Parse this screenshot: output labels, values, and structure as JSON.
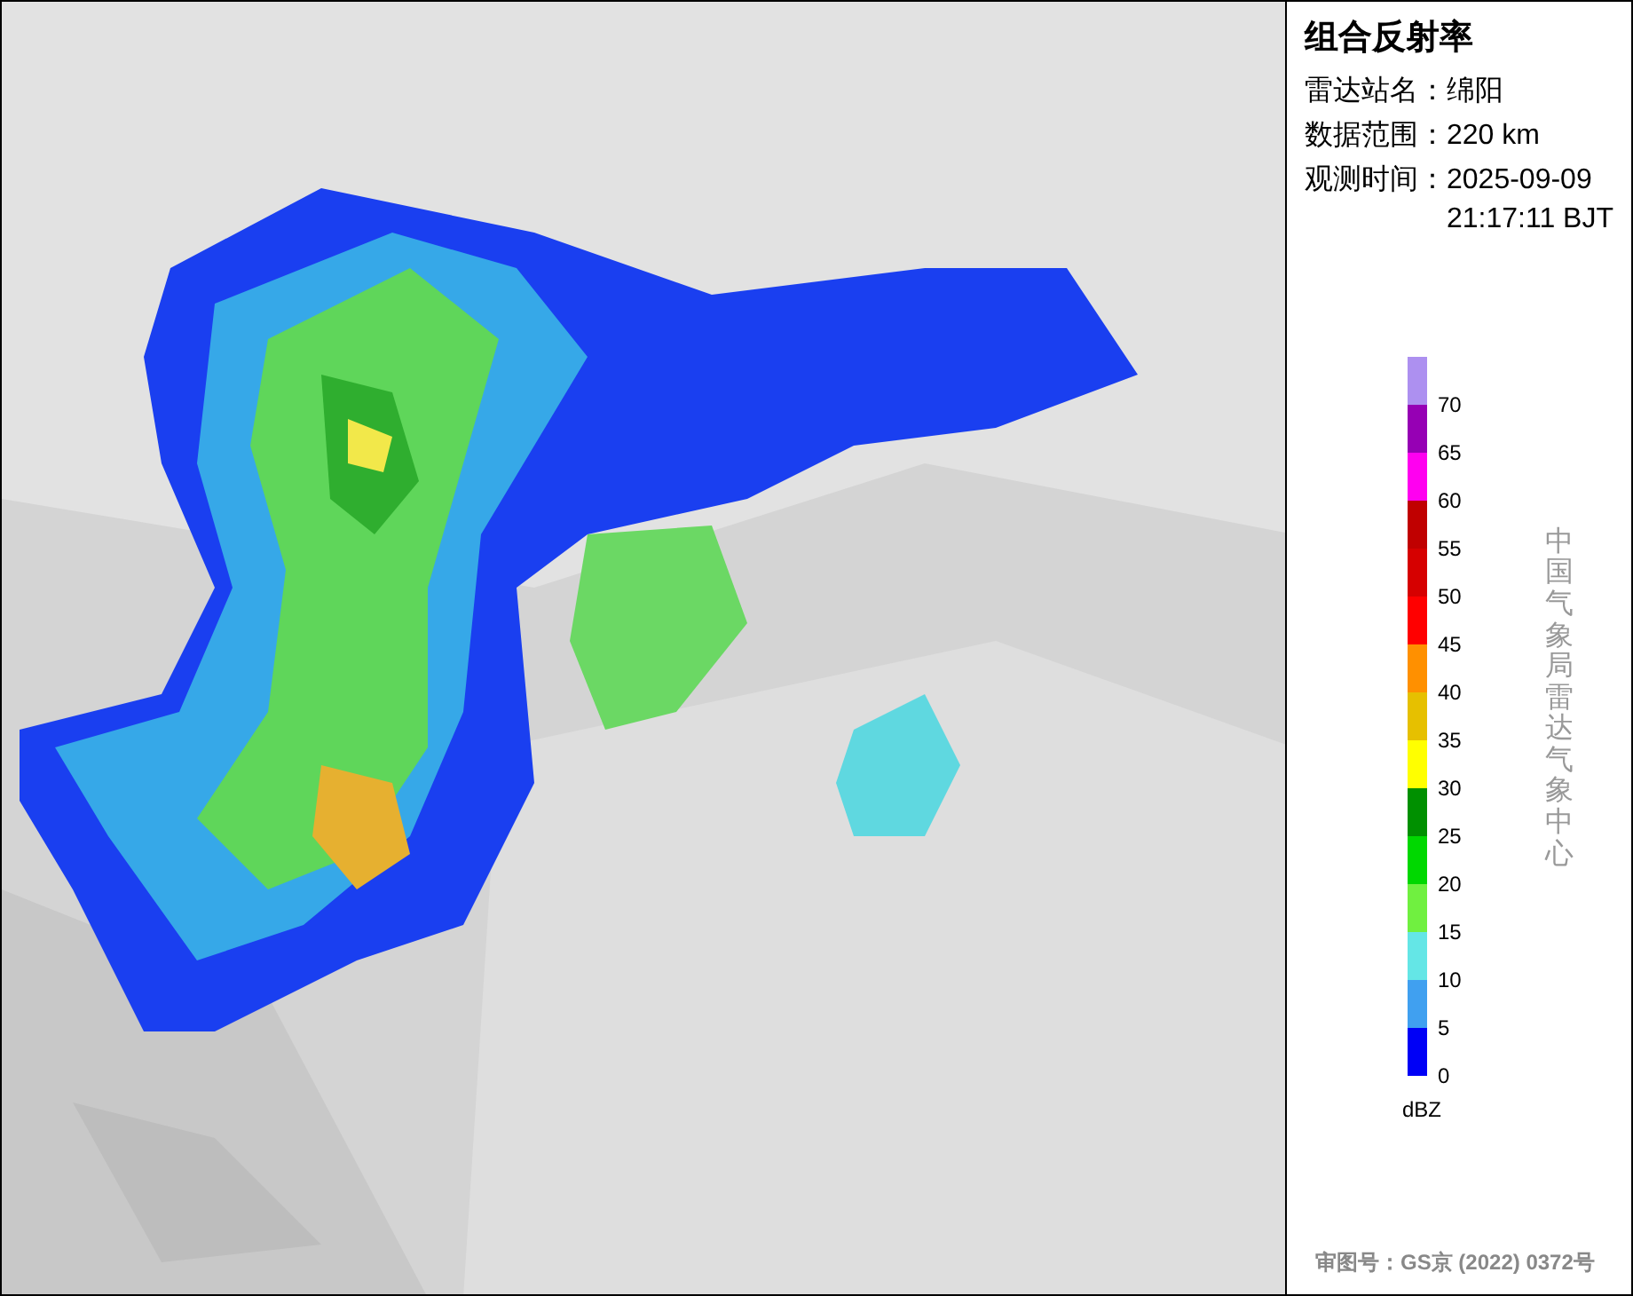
{
  "panel": {
    "title": "组合反射率",
    "info": [
      {
        "label": "雷达站名：",
        "value": "绵阳"
      },
      {
        "label": "数据范围：",
        "value": "220 km"
      },
      {
        "label": "观测时间：",
        "value": "2025-09-09 21:17:11 BJT"
      }
    ],
    "legend": {
      "unit": "dBZ",
      "items": [
        {
          "label": "70",
          "color": "#ad90f0"
        },
        {
          "label": "65",
          "color": "#9600b4"
        },
        {
          "label": "60",
          "color": "#ff00f0"
        },
        {
          "label": "55",
          "color": "#c00000"
        },
        {
          "label": "50",
          "color": "#d60000"
        },
        {
          "label": "45",
          "color": "#ff0000"
        },
        {
          "label": "40",
          "color": "#ff9000"
        },
        {
          "label": "35",
          "color": "#e6c000"
        },
        {
          "label": "30",
          "color": "#ffff00"
        },
        {
          "label": "25",
          "color": "#009000"
        },
        {
          "label": "20",
          "color": "#00d800"
        },
        {
          "label": "15",
          "color": "#70f040"
        },
        {
          "label": "10",
          "color": "#64e6e6"
        },
        {
          "label": "5",
          "color": "#40a0f0"
        },
        {
          "label": "0",
          "color": "#0000f6"
        }
      ]
    },
    "source": "中国气象局雷达气象中心",
    "approval": "审图号：GS京 (2022) 0372号"
  }
}
